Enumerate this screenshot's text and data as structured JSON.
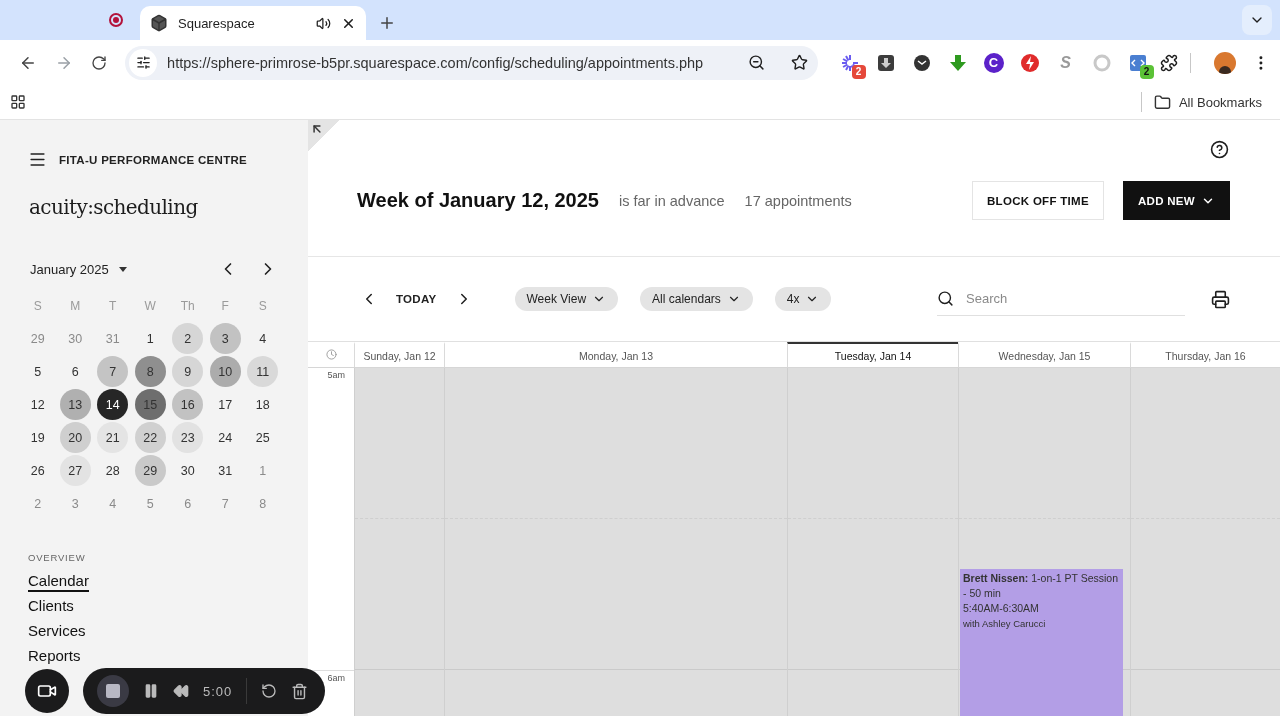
{
  "browser": {
    "tabs": [
      {
        "kind": "recording",
        "selected": false
      },
      {
        "kind": "page",
        "title": "Squarespace",
        "selected": true,
        "audio": true
      }
    ],
    "url": "https://sphere-primrose-b5pr.squarespace.com/config/scheduling/appointments.php",
    "extensions": [
      {
        "kind": "spinner",
        "badge": "2",
        "color": "#6a5cf0"
      },
      {
        "kind": "download-box",
        "color": "#3c3c3c"
      },
      {
        "kind": "dark-dial",
        "color": "#333333"
      },
      {
        "kind": "green-arrow",
        "color": "#2e9a1f"
      },
      {
        "kind": "letter",
        "text": "C",
        "color": "#5b21c9"
      },
      {
        "kind": "bolt",
        "color": "#e02b2b"
      },
      {
        "kind": "plain-letter",
        "text": "S",
        "color": "#9a9a9a"
      },
      {
        "kind": "ring",
        "color": "#c8c8c8"
      },
      {
        "kind": "code",
        "badge": "2",
        "color": "#4a7fd1"
      }
    ],
    "bookmarks": [
      "All Bookmarks"
    ]
  },
  "sidebar": {
    "business": "FITA-U PERFORMANCE CENTRE",
    "logo": "acuity:scheduling",
    "mini_calendar": {
      "month": "January 2025",
      "weekdays": [
        "S",
        "M",
        "T",
        "W",
        "Th",
        "F",
        "S"
      ],
      "weeks": [
        [
          {
            "day": "29",
            "other_month": true
          },
          {
            "day": "30",
            "other_month": true
          },
          {
            "day": "31",
            "other_month": true
          },
          {
            "day": "1",
            "other_month": false
          },
          {
            "day": "2",
            "other_month": false,
            "color": "#d6d6d6"
          },
          {
            "day": "3",
            "other_month": false,
            "color": "#c2c2c2"
          },
          {
            "day": "4",
            "other_month": false
          }
        ],
        [
          {
            "day": "5",
            "other_month": false
          },
          {
            "day": "6",
            "other_month": false
          },
          {
            "day": "7",
            "other_month": false,
            "color": "#c4c4c4"
          },
          {
            "day": "8",
            "other_month": false,
            "color": "#8f8f8f"
          },
          {
            "day": "9",
            "other_month": false,
            "color": "#d6d6d6"
          },
          {
            "day": "10",
            "other_month": false,
            "color": "#acacac"
          },
          {
            "day": "11",
            "other_month": false,
            "color": "#d9d9d9"
          }
        ],
        [
          {
            "day": "12",
            "other_month": false
          },
          {
            "day": "13",
            "other_month": false,
            "color": "#b0b0b0"
          },
          {
            "day": "14",
            "other_month": false,
            "selected": true
          },
          {
            "day": "15",
            "other_month": false,
            "color": "#6e6e6e"
          },
          {
            "day": "16",
            "other_month": false,
            "color": "#c2c2c2"
          },
          {
            "day": "17",
            "other_month": false
          },
          {
            "day": "18",
            "other_month": false
          }
        ],
        [
          {
            "day": "19",
            "other_month": false
          },
          {
            "day": "20",
            "other_month": false,
            "color": "#cfcfcf"
          },
          {
            "day": "21",
            "other_month": false,
            "color": "#e4e4e4"
          },
          {
            "day": "22",
            "other_month": false,
            "color": "#d0d0d0"
          },
          {
            "day": "23",
            "other_month": false,
            "color": "#e2e2e2"
          },
          {
            "day": "24",
            "other_month": false
          },
          {
            "day": "25",
            "other_month": false
          }
        ],
        [
          {
            "day": "26",
            "other_month": false
          },
          {
            "day": "27",
            "other_month": false,
            "color": "#e3e3e3"
          },
          {
            "day": "28",
            "other_month": false
          },
          {
            "day": "29",
            "other_month": false,
            "color": "#c9c9c9"
          },
          {
            "day": "30",
            "other_month": false
          },
          {
            "day": "31",
            "other_month": false
          },
          {
            "day": "1",
            "other_month": true
          }
        ],
        [
          {
            "day": "2",
            "other_month": true
          },
          {
            "day": "3",
            "other_month": true
          },
          {
            "day": "4",
            "other_month": true
          },
          {
            "day": "5",
            "other_month": true
          },
          {
            "day": "6",
            "other_month": true
          },
          {
            "day": "7",
            "other_month": true
          },
          {
            "day": "8",
            "other_month": true
          }
        ]
      ]
    },
    "section": "OVERVIEW",
    "nav": [
      {
        "label": "Calendar",
        "selected": true
      },
      {
        "label": "Clients",
        "selected": false
      },
      {
        "label": "Services",
        "selected": false
      },
      {
        "label": "Reports",
        "selected": false
      }
    ]
  },
  "recorder": {
    "time": "5:00"
  },
  "header": {
    "title": "Week of January 12, 2025",
    "note": "is far in advance",
    "count": "17 appointments",
    "buttons": [
      {
        "label": "BLOCK OFF TIME",
        "kind": "outline"
      },
      {
        "label": "ADD NEW",
        "kind": "dropdown"
      }
    ]
  },
  "toolbar": {
    "today": "TODAY",
    "filters": [
      "Week View",
      "All calendars",
      "4x"
    ],
    "search": {
      "placeholder": "Search"
    }
  },
  "calendar": {
    "times": [
      "5am",
      "6am"
    ],
    "days": [
      {
        "label": "Sunday, Jan 12",
        "selected": false
      },
      {
        "label": "Monday, Jan 13",
        "selected": false
      },
      {
        "label": "Tuesday, Jan 14",
        "selected": true
      },
      {
        "label": "Wednesday, Jan 15",
        "selected": false,
        "events": [
          {
            "title": "**Brett Nissen:**  1-on-1 PT Session - 50 min",
            "time": "5:40AM-6:30AM",
            "staff": "with Ashley Carucci",
            "color": "#b39ee6"
          }
        ]
      },
      {
        "label": "Thursday, Jan 16",
        "selected": false
      }
    ]
  }
}
